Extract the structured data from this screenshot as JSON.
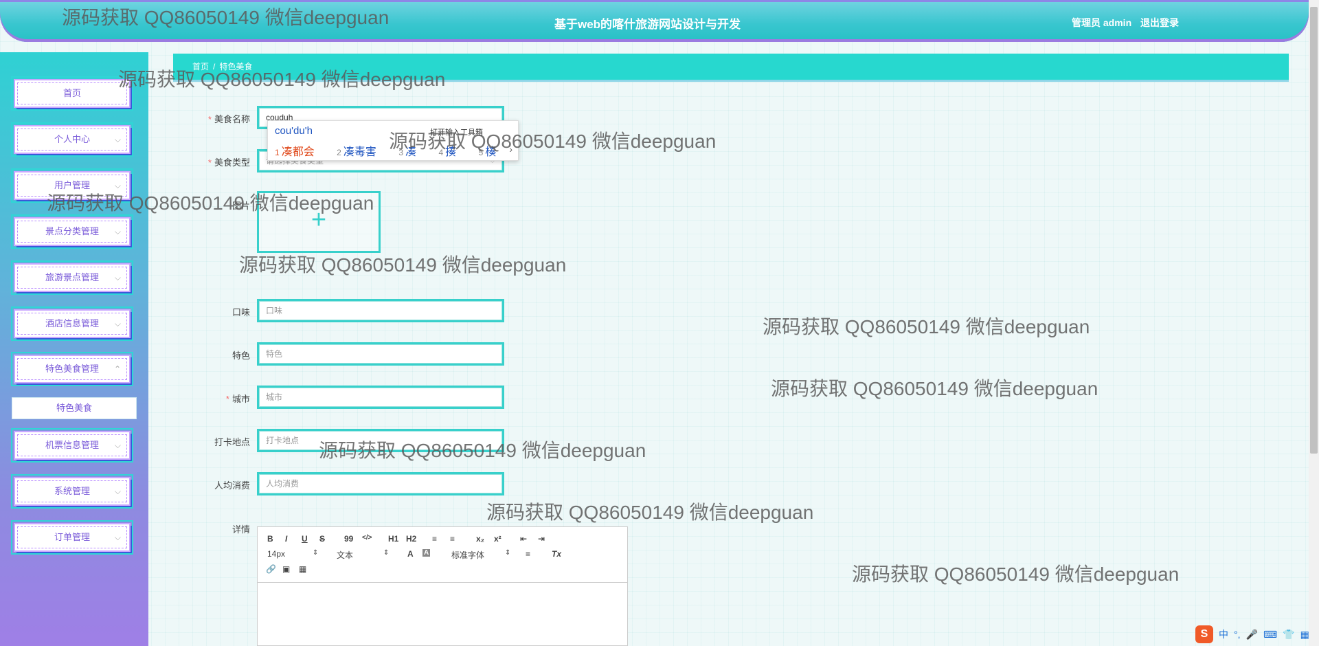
{
  "header": {
    "title": "基于web的喀什旅游网站设计与开发",
    "user": "管理员 admin",
    "logout": "退出登录"
  },
  "sidebar": {
    "items": [
      {
        "label": "首页"
      },
      {
        "label": "个人中心"
      },
      {
        "label": "用户管理"
      },
      {
        "label": "景点分类管理"
      },
      {
        "label": "旅游景点管理"
      },
      {
        "label": "酒店信息管理"
      },
      {
        "label": "特色美食管理"
      },
      {
        "label": "机票信息管理"
      },
      {
        "label": "系统管理"
      },
      {
        "label": "订单管理"
      }
    ],
    "submenu_active": "特色美食"
  },
  "breadcrumb": {
    "home": "首页",
    "sep": "/",
    "current": "特色美食"
  },
  "form": {
    "name": {
      "label": "美食名称",
      "value": "couduh"
    },
    "type": {
      "label": "美食类型",
      "placeholder": "请选择美食类型"
    },
    "image": {
      "label": "图片"
    },
    "taste": {
      "label": "口味",
      "placeholder": "口味"
    },
    "feature": {
      "label": "特色",
      "placeholder": "特色"
    },
    "city": {
      "label": "城市",
      "placeholder": "城市"
    },
    "checkin": {
      "label": "打卡地点",
      "placeholder": "打卡地点"
    },
    "avg_cost": {
      "label": "人均消费",
      "placeholder": "人均消费"
    },
    "detail": {
      "label": "详情"
    }
  },
  "ime": {
    "composition": "cou'du'h",
    "tool_hint": "打开输入工具箱",
    "candidates": [
      {
        "n": "1",
        "t": "凑都会"
      },
      {
        "n": "2",
        "t": "凑毒害"
      },
      {
        "n": "3",
        "t": "凑"
      },
      {
        "n": "4",
        "t": "揍"
      },
      {
        "n": "5",
        "t": "楱"
      }
    ]
  },
  "editor": {
    "font_size": "14px",
    "text_style": "文本",
    "font_family": "标准字体",
    "buttons": [
      "B",
      "I",
      "U",
      "S",
      "99",
      "</>",
      "H1",
      "H2",
      "≡",
      "≡",
      "x₂",
      "x²",
      "⇤",
      "⇥",
      "A",
      "A",
      "≡",
      "Tx"
    ]
  },
  "watermark": "源码获取 QQ86050149 微信deepguan",
  "tray": {
    "ime_mode": "中"
  }
}
